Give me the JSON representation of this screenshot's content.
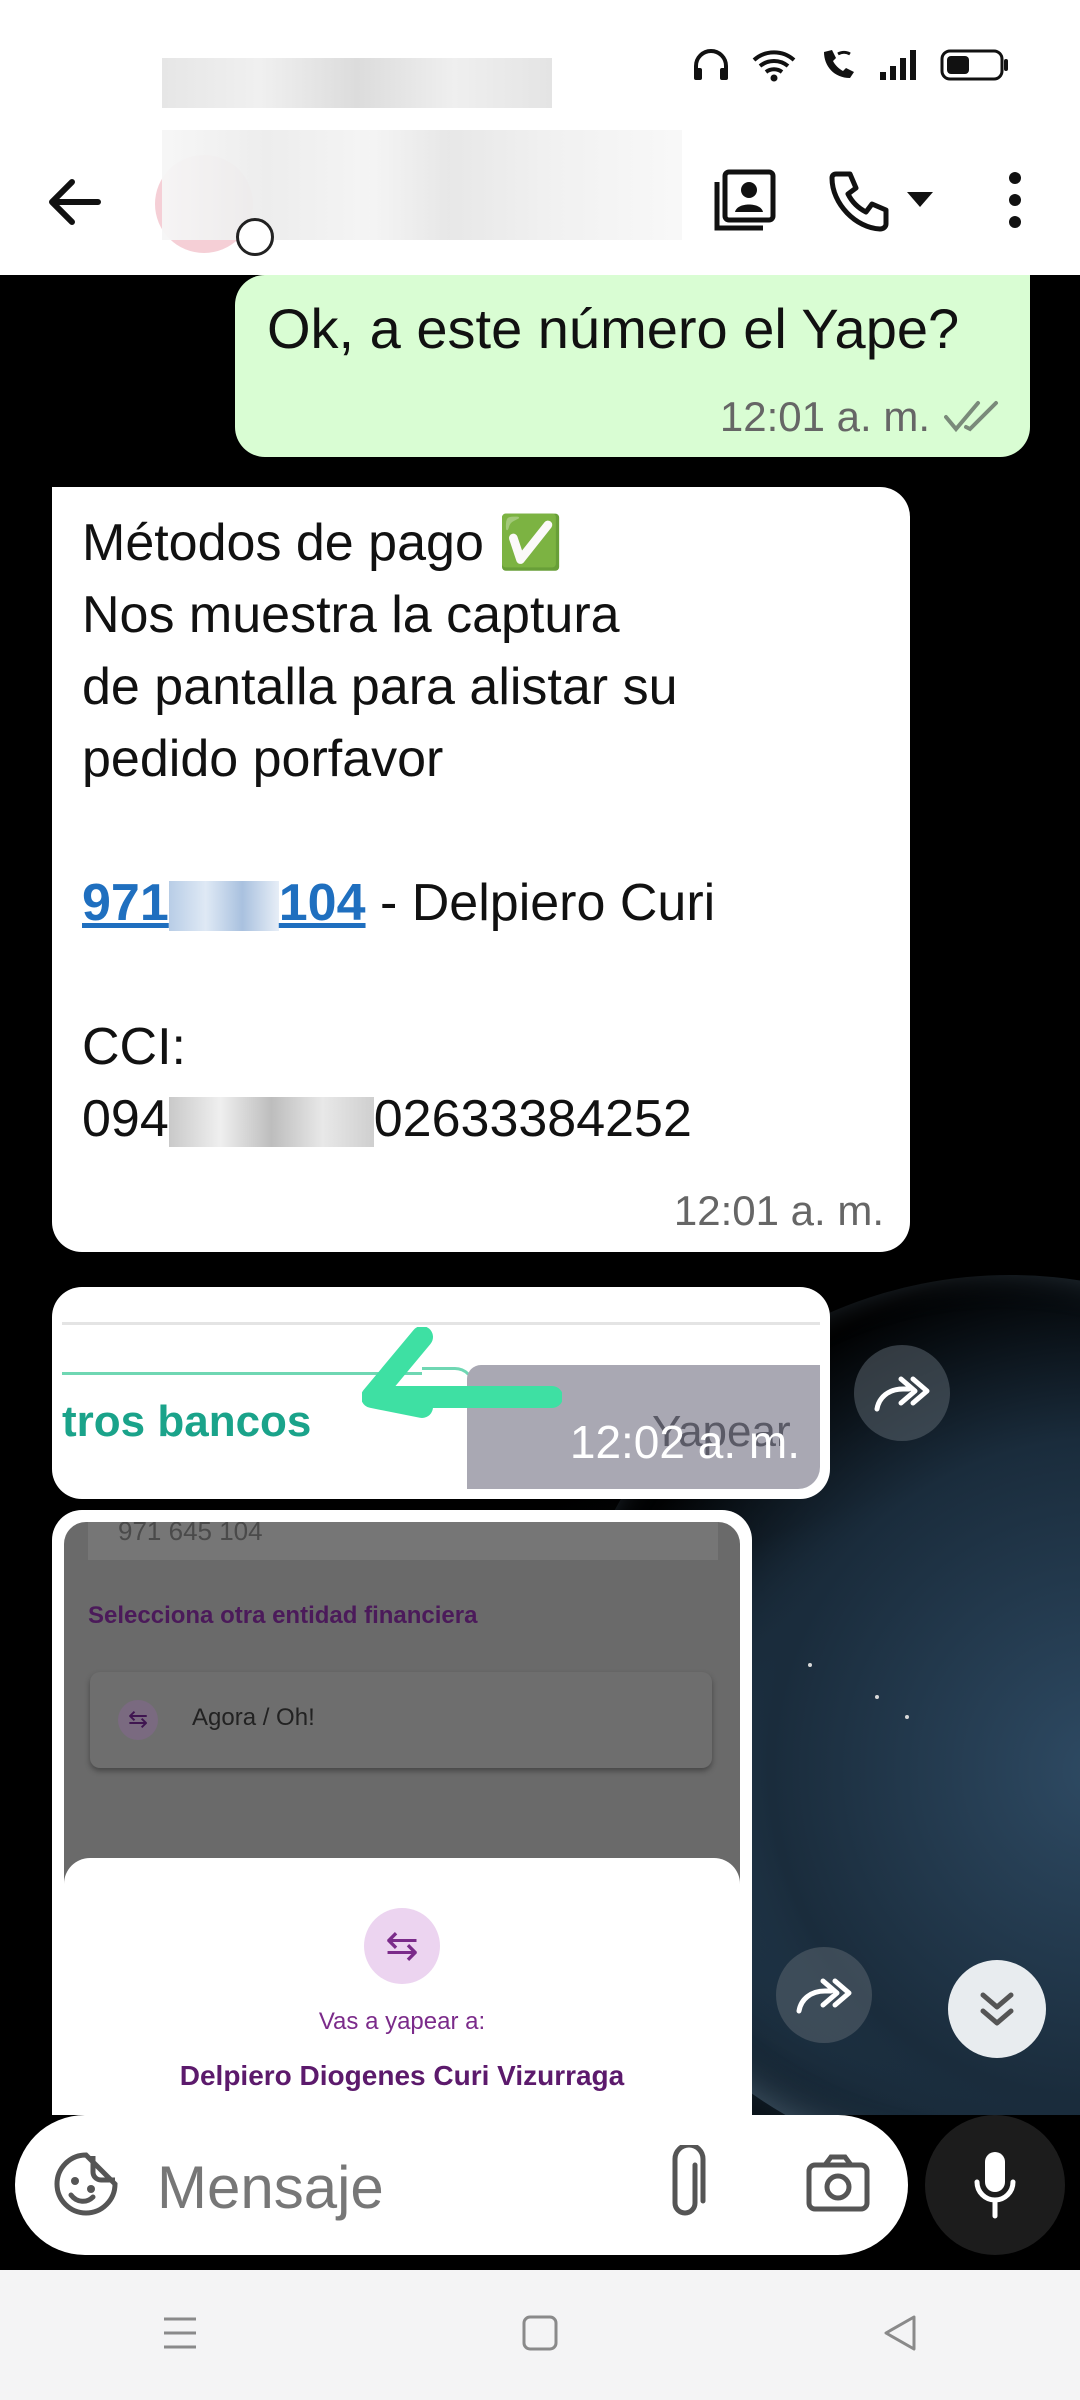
{
  "chat": {
    "messages": [
      {
        "text": "Ok, a este número el Yape?",
        "time": "12:01 a. m."
      },
      {
        "line1": "Métodos de pago ✅",
        "line2": "Nos muestra la captura",
        "line3": "de pantalla para alistar su",
        "line4": "pedido porfavor",
        "phone_start": "971",
        "phone_end": "104",
        "phone_suffix": " - Delpiero Curi",
        "cci_label": "CCI:",
        "cci_start": "094",
        "cci_end": "02633384252",
        "time": "12:01 a. m."
      },
      {
        "image_text_left": "tros bancos",
        "image_text_right": "Yapear",
        "time": "12:02 a. m."
      },
      {
        "top_number": "971 645 104",
        "heading": "Selecciona otra entidad financiera",
        "entity": "Agora / Oh!",
        "sheet_label": "Vas a yapear a:",
        "recipient": "Delpiero Diogenes Curi Vizurraga"
      }
    ]
  },
  "input": {
    "placeholder": "Mensaje"
  },
  "colors": {
    "outgoing": "#d9fdd3",
    "incoming": "#ffffff",
    "link": "#1f6fbf",
    "yape_purple": "#742384",
    "yape_green": "#3ee0a3"
  }
}
